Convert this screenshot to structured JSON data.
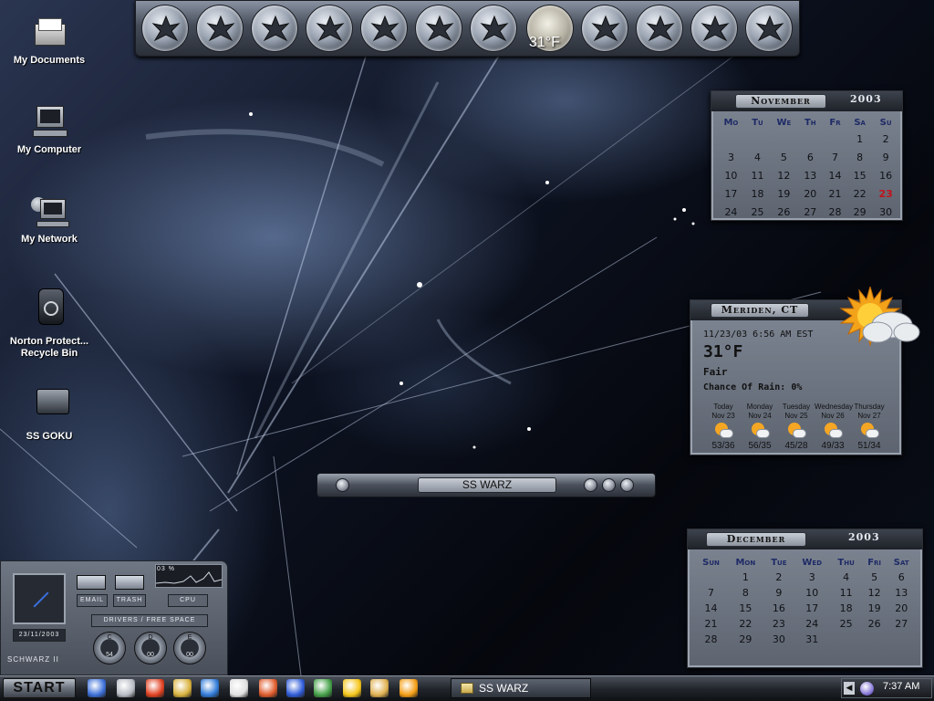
{
  "desktop": {
    "icons": [
      {
        "label": "My Documents",
        "icon": "folder-docs-icon"
      },
      {
        "label": "My Computer",
        "icon": "computer-icon"
      },
      {
        "label": "My Network",
        "icon": "network-icon"
      },
      {
        "label": "Norton Protect... Recycle Bin",
        "icon": "recycle-bin-icon"
      },
      {
        "label": "SS GOKU",
        "icon": "folder-icon"
      }
    ]
  },
  "dock": {
    "temperature": "31°F",
    "buttons": [
      "tribal-1",
      "tribal-2",
      "tribal-3",
      "tribal-4",
      "tribal-5",
      "tribal-6",
      "dragon-7",
      "weather-orb",
      "tribal-9",
      "scorpion-10",
      "dragon-11",
      "dragon-12"
    ]
  },
  "calendar_nov": {
    "month": "November",
    "year": "2003",
    "weekdays": [
      "Mo",
      "Tu",
      "We",
      "Th",
      "Fr",
      "Sa",
      "Su"
    ],
    "weeks": [
      [
        "",
        "",
        "",
        "",
        "",
        "1",
        "2"
      ],
      [
        "3",
        "4",
        "5",
        "6",
        "7",
        "8",
        "9"
      ],
      [
        "10",
        "11",
        "12",
        "13",
        "14",
        "15",
        "16"
      ],
      [
        "17",
        "18",
        "19",
        "20",
        "21",
        "22",
        "23"
      ],
      [
        "24",
        "25",
        "26",
        "27",
        "28",
        "29",
        "30"
      ]
    ],
    "today": "23"
  },
  "weather": {
    "location": "Meriden, CT",
    "datetime": "11/23/03 6:56 AM EST",
    "temp": "31°F",
    "condition": "Fair",
    "rain": "Chance Of Rain: 0%",
    "days": [
      {
        "day": "Today",
        "date": "Nov 23",
        "hilo": "53/36"
      },
      {
        "day": "Monday",
        "date": "Nov 24",
        "hilo": "56/35"
      },
      {
        "day": "Tuesday",
        "date": "Nov 25",
        "hilo": "45/28"
      },
      {
        "day": "Wednesday",
        "date": "Nov 26",
        "hilo": "49/33"
      },
      {
        "day": "Thursday",
        "date": "Nov 27",
        "hilo": "51/34"
      }
    ]
  },
  "warz_bar": {
    "title": "SS WARZ"
  },
  "calendar_dec": {
    "month": "December",
    "year": "2003",
    "weekdays": [
      "Sun",
      "Mon",
      "Tue",
      "Wed",
      "Thu",
      "Fri",
      "Sat"
    ],
    "weeks": [
      [
        "",
        "1",
        "2",
        "3",
        "4",
        "5",
        "6"
      ],
      [
        "7",
        "8",
        "9",
        "10",
        "11",
        "12",
        "13"
      ],
      [
        "14",
        "15",
        "16",
        "17",
        "18",
        "19",
        "20"
      ],
      [
        "21",
        "22",
        "23",
        "24",
        "25",
        "26",
        "27"
      ],
      [
        "28",
        "29",
        "30",
        "31",
        "",
        "",
        ""
      ]
    ]
  },
  "sysmon": {
    "cpu_pct": "03 %",
    "email": "EMAIL",
    "trash": "TRASH",
    "cpu": "CPU",
    "date": "23/11/2003",
    "drives_label": "DRIVERS / FREE SPACE",
    "drives": [
      {
        "letter": "C",
        "value": "54"
      },
      {
        "letter": "D",
        "value": "00"
      },
      {
        "letter": "E",
        "value": "00"
      }
    ],
    "skin": "SCHWARZ II"
  },
  "taskbar": {
    "start": "START",
    "task": "SS WARZ",
    "clock": "7:37 AM",
    "quick_launch": [
      "ie-icon",
      "camera-icon",
      "smiley-icon",
      "notepad-icon",
      "outlook-icon",
      "windows-icon",
      "pictures-icon",
      "media-icon",
      "chrome-icon",
      "folder-icon",
      "flash-icon",
      "winamp-icon"
    ]
  },
  "colors": {
    "accent_today": "#c0141a",
    "weekday": "#1e2a66"
  }
}
